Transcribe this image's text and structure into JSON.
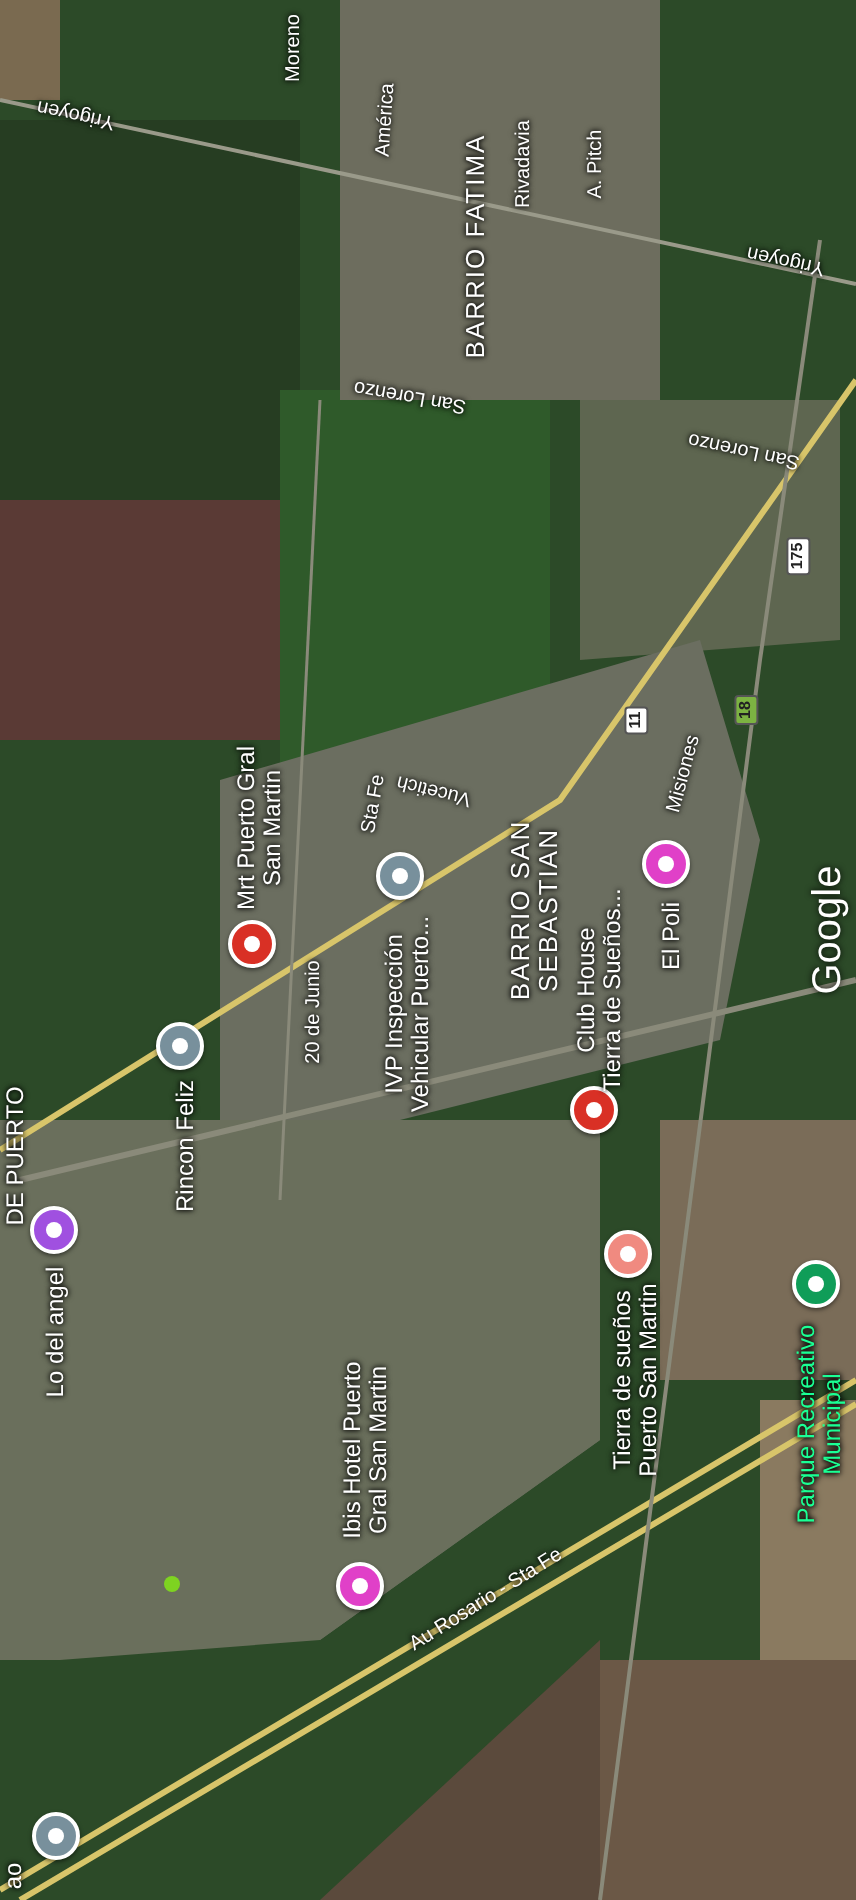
{
  "map": {
    "streets": [
      {
        "text": "Moreno"
      },
      {
        "text": "Yrigoyen"
      },
      {
        "text": "América"
      },
      {
        "text": "Rivadavia"
      },
      {
        "text": "A. Pitch"
      },
      {
        "text": "Yrigoyen"
      },
      {
        "text": "San Lorenzo"
      },
      {
        "text": "San Lorenzo"
      },
      {
        "text": "Vucetich"
      },
      {
        "text": "Sta Fe"
      },
      {
        "text": "20 de Junio"
      },
      {
        "text": "Misiones"
      },
      {
        "text": "Au Rosario - Sta Fe"
      }
    ],
    "areas": [
      {
        "lines": [
          "BARRIO FATIMA"
        ]
      },
      {
        "lines": [
          "BARRIO SAN",
          "SEBASTIAN"
        ]
      }
    ],
    "route_shields": [
      {
        "text": "175",
        "color": "#ffffff"
      },
      {
        "text": "11",
        "color": "#ffffff"
      },
      {
        "text": "18",
        "color": "#7cb342"
      }
    ],
    "places": [
      {
        "kind": "poi",
        "color": "#d93025",
        "lines": [
          "Mrt Puerto Gral",
          "San Martin"
        ]
      },
      {
        "kind": "poi",
        "color": "#78909c",
        "lines": [
          "IVP Inspección",
          "Vehicular Puerto..."
        ]
      },
      {
        "kind": "poi",
        "color": "#d93025",
        "lines": [
          "Club House",
          "Tierra de Sueños..."
        ]
      },
      {
        "kind": "poi",
        "color": "#e040c8",
        "lines": [
          "El Poli"
        ]
      },
      {
        "kind": "poi",
        "color": "#78909c",
        "lines": [
          "Rincon Feliz"
        ]
      },
      {
        "kind": "poi",
        "color": "#a050e0",
        "lines": [
          "Lo del angel"
        ]
      },
      {
        "kind": "poi",
        "color": "#f08a80",
        "lines": [
          "Tierra de sueños",
          "Puerto San Martin"
        ]
      },
      {
        "kind": "park",
        "color": "#0f9d58",
        "lines": [
          "Parque Recreativo",
          "Municipal"
        ]
      },
      {
        "kind": "poi",
        "color": "#e040c8",
        "lines": [
          "Ibis Hotel Puerto",
          "Gral San Martin"
        ]
      },
      {
        "kind": "poi",
        "color": "#78909c"
      }
    ],
    "markers": [
      {
        "color": "#7ed321"
      }
    ],
    "edge_labels": [
      {
        "text": "DE PUERTO"
      },
      {
        "text": "ao"
      }
    ],
    "attribution": "Google"
  }
}
